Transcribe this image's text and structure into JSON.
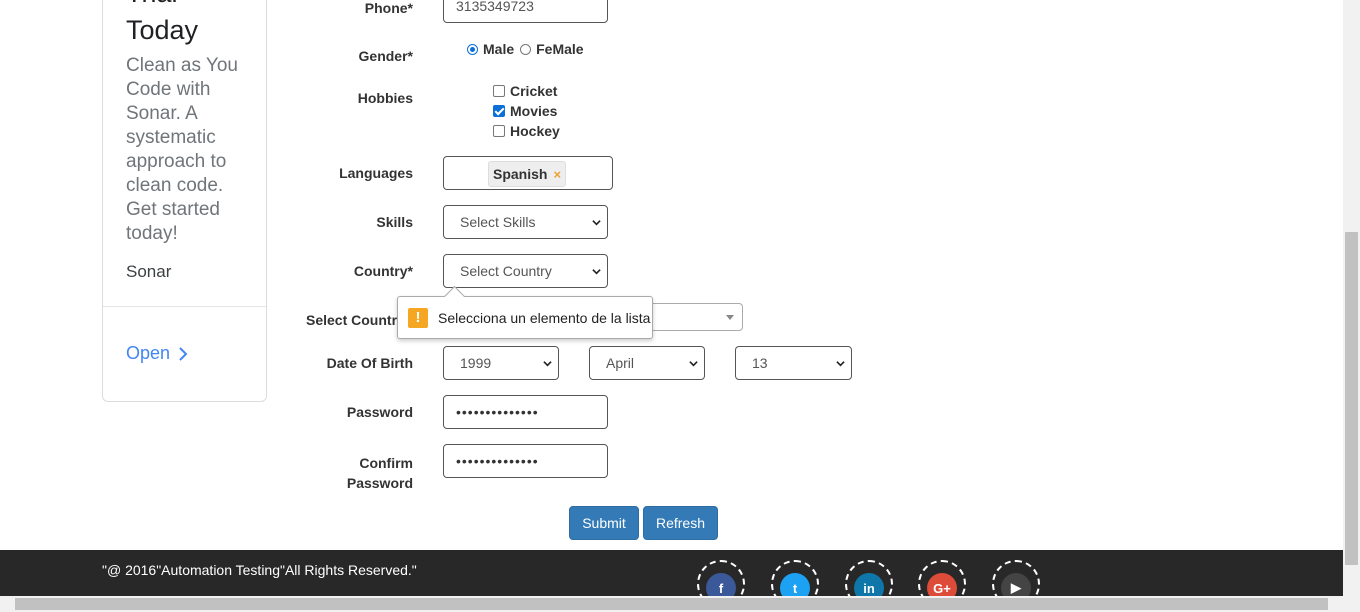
{
  "ad": {
    "title_line1": "Trial",
    "title_line2": "Today",
    "body": "Clean as You Code with Sonar. A systematic approach to clean code. Get started today!",
    "brand": "Sonar",
    "open_label": "Open"
  },
  "form": {
    "phone": {
      "label": "Phone*",
      "value": "3135349723"
    },
    "gender": {
      "label": "Gender*",
      "options": [
        "Male",
        "FeMale"
      ],
      "selected": "Male"
    },
    "hobbies": {
      "label": "Hobbies",
      "items": [
        {
          "label": "Cricket",
          "checked": false
        },
        {
          "label": "Movies",
          "checked": true
        },
        {
          "label": "Hockey",
          "checked": false
        }
      ]
    },
    "languages": {
      "label": "Languages",
      "selected_tag": "Spanish",
      "remove_glyph": "×"
    },
    "skills": {
      "label": "Skills",
      "value": "Select Skills"
    },
    "country": {
      "label": "Country*",
      "value": "Select Country"
    },
    "select_country": {
      "label": "Select Country"
    },
    "dob": {
      "label": "Date Of Birth",
      "year": "1999",
      "month": "April",
      "day": "13"
    },
    "password": {
      "label": "Password",
      "value": "••••••••••••••"
    },
    "confirm_password": {
      "label_line1": "Confirm",
      "label_line2": "Password",
      "value": "••••••••••••••"
    },
    "submit_label": "Submit",
    "refresh_label": "Refresh"
  },
  "tooltip": {
    "icon": "!",
    "text": "Selecciona un elemento de la lista"
  },
  "footer": {
    "copyright": "\"@ 2016\"Automation Testing\"All Rights Reserved.\"",
    "social": [
      {
        "name": "facebook",
        "color": "#3b5998",
        "glyph": "f"
      },
      {
        "name": "twitter",
        "color": "#1da1f2",
        "glyph": "t"
      },
      {
        "name": "linkedin",
        "color": "#0e76a8",
        "glyph": "in"
      },
      {
        "name": "google-plus",
        "color": "#dd4b39",
        "glyph": "G+"
      },
      {
        "name": "youtube",
        "color": "#444444",
        "glyph": "▶"
      }
    ]
  },
  "colors": {
    "primary_button": "#337ab7",
    "footer_bg": "#282828",
    "ad_link": "#4285f4",
    "warning": "#f5a623"
  }
}
